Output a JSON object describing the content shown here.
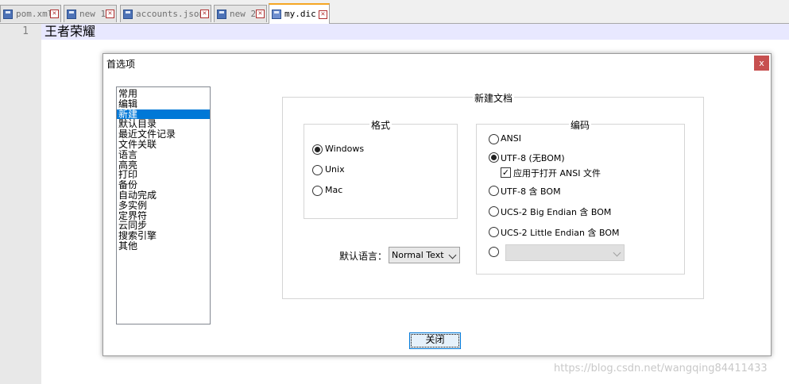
{
  "tabs": [
    {
      "label": "pom.xml",
      "active": false
    },
    {
      "label": "new 1",
      "active": false
    },
    {
      "label": "accounts.json",
      "active": false
    },
    {
      "label": "new 2",
      "active": false
    },
    {
      "label": "my.dic",
      "active": true
    }
  ],
  "editor": {
    "line_number": "1",
    "text": "王者荣耀"
  },
  "dialog": {
    "title": "首选项",
    "close_glyph": "x",
    "categories": [
      "常用",
      "编辑",
      "新建",
      "默认目录",
      "最近文件记录",
      "文件关联",
      "语言",
      "高亮",
      "打印",
      "备份",
      "自动完成",
      "多实例",
      "定界符",
      "云同步",
      "搜索引擎",
      "其他"
    ],
    "selected_category": "新建",
    "new_doc_group": "新建文档",
    "format": {
      "title": "格式",
      "options": [
        {
          "label": "Windows",
          "selected": true
        },
        {
          "label": "Unix",
          "selected": false
        },
        {
          "label": "Mac",
          "selected": false
        }
      ]
    },
    "encoding": {
      "title": "编码",
      "options": [
        {
          "label": "ANSI",
          "selected": false
        },
        {
          "label": "UTF-8 (无BOM)",
          "selected": true
        },
        {
          "label": "UTF-8 含 BOM",
          "selected": false
        },
        {
          "label": "UCS-2 Big Endian 含 BOM",
          "selected": false
        },
        {
          "label": "UCS-2 Little Endian 含 BOM",
          "selected": false
        }
      ],
      "apply_ansi_label": "应用于打开 ANSI 文件",
      "apply_ansi_checked": true,
      "other_select_value": ""
    },
    "default_lang_label": "默认语言：",
    "default_lang_value": "Normal Text",
    "close_button": "关闭"
  },
  "watermark": "https://blog.csdn.net/wangqing84411433",
  "colors": {
    "tab_active_accent": "#f5a623",
    "selection": "#0078d7",
    "close_button_bg": "#c75050",
    "current_line": "#e8e8ff"
  }
}
